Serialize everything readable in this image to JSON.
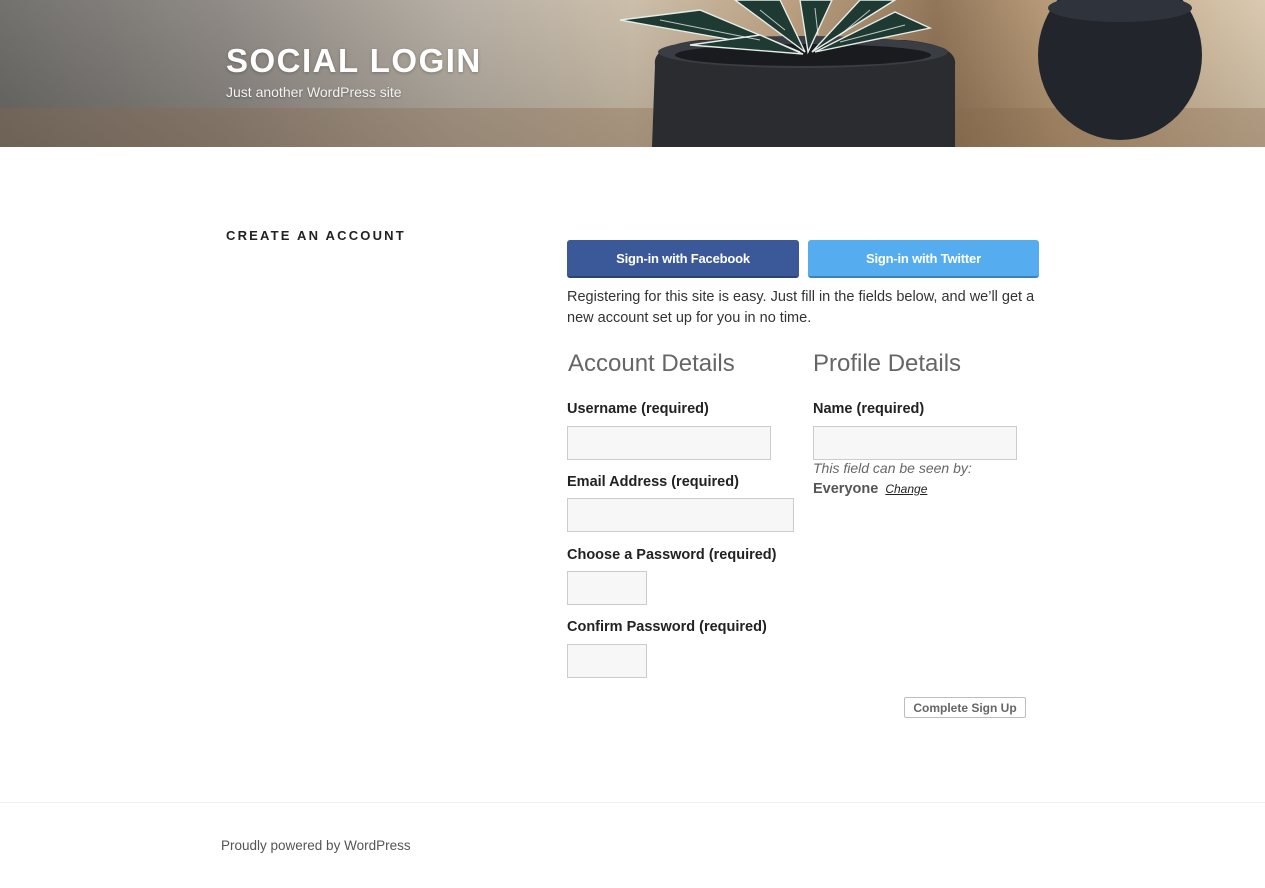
{
  "header": {
    "site_title": "SOCIAL LOGIN",
    "tagline": "Just another WordPress site"
  },
  "page": {
    "title": "CREATE AN ACCOUNT"
  },
  "social": {
    "facebook_label": "Sign-in with Facebook",
    "twitter_label": "Sign-in with Twitter"
  },
  "intro": "Registering for this site is easy. Just fill in the fields below, and we’ll get a new account set up for you in no time.",
  "account": {
    "heading": "Account Details",
    "username_label": "Username (required)",
    "username_value": "",
    "email_label": "Email Address (required)",
    "email_value": "",
    "password_label": "Choose a Password (required)",
    "password_value": "",
    "confirm_label": "Confirm Password (required)",
    "confirm_value": ""
  },
  "profile": {
    "heading": "Profile Details",
    "name_label": "Name (required)",
    "name_value": "",
    "visibility_note": "This field can be seen by:",
    "visibility_value": "Everyone",
    "change_label": "Change"
  },
  "submit_label": "Complete Sign Up",
  "footer": {
    "credit": "Proudly powered by WordPress"
  },
  "colors": {
    "facebook": "#3b5998",
    "twitter": "#55acee"
  }
}
